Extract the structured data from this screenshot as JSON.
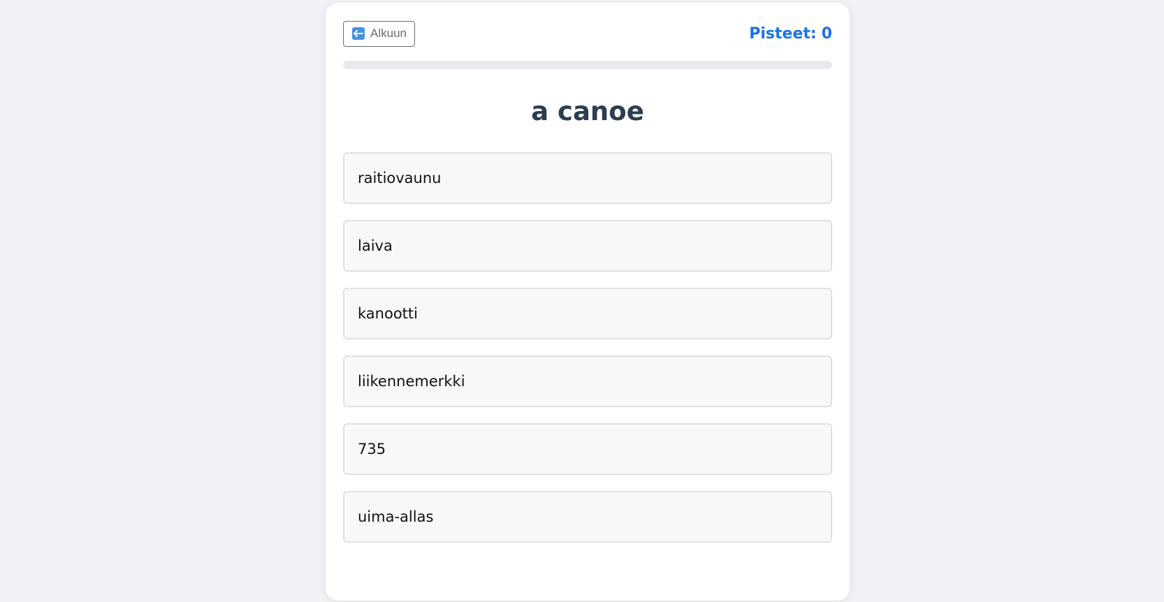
{
  "header": {
    "back_label": "Alkuun",
    "score_label": "Pisteet:",
    "score_value": "0"
  },
  "progress": {
    "fraction": 0
  },
  "question": {
    "word": "a canoe"
  },
  "options": [
    {
      "label": "raitiovaunu"
    },
    {
      "label": "laiva"
    },
    {
      "label": "kanootti"
    },
    {
      "label": "liikennemerkki"
    },
    {
      "label": "735"
    },
    {
      "label": "uima-allas"
    }
  ],
  "colors": {
    "accent": "#1a73e8",
    "question_text": "#2c3e50",
    "background": "#f0f2f5"
  },
  "icons": {
    "back": "arrow-left-icon"
  }
}
